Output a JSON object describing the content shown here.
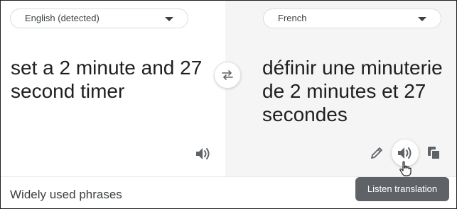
{
  "source": {
    "language_label": "English (detected)",
    "text": "set a 2 minute and 27\nsecond timer",
    "icons": {
      "dropdown": "chevron-down-icon",
      "speaker": "speaker-icon"
    }
  },
  "target": {
    "language_label": "French",
    "text": "définir une minuterie\nde 2 minutes et 27\nsecondes",
    "icons": {
      "dropdown": "chevron-down-icon",
      "edit": "pencil-icon",
      "speaker": "speaker-icon",
      "copy": "copy-icon"
    }
  },
  "swap": {
    "icon": "swap-arrows-icon"
  },
  "tooltip": {
    "text": "Listen translation"
  },
  "footer": {
    "phrases_label": "Widely used phrases"
  },
  "colors": {
    "right_pane_bg": "#f5f5f5",
    "tooltip_bg": "#5f6368",
    "icon": "#5f6368"
  }
}
